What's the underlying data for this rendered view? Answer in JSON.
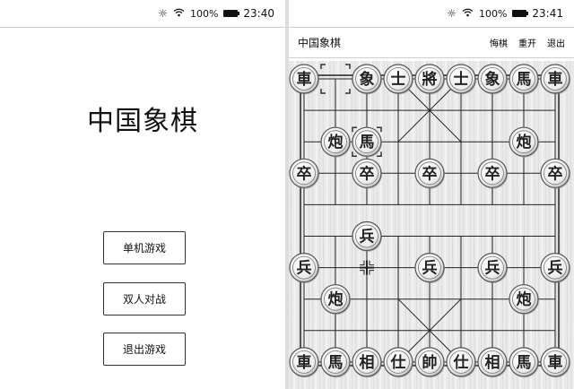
{
  "left_screen": {
    "status": {
      "battery": "100%",
      "time": "23:40"
    },
    "title": "中国象棋",
    "buttons": [
      "单机游戏",
      "双人对战",
      "退出游戏"
    ]
  },
  "right_screen": {
    "status": {
      "battery": "100%",
      "time": "23:41"
    },
    "header": {
      "title": "中国象棋",
      "undo": "悔棋",
      "restart": "重开",
      "exit": "退出"
    },
    "board": {
      "top_side": [
        {
          "name": "車",
          "col": 0,
          "row": 0
        },
        {
          "name": "象",
          "col": 2,
          "row": 0
        },
        {
          "name": "士",
          "col": 3,
          "row": 0
        },
        {
          "name": "將",
          "col": 4,
          "row": 0
        },
        {
          "name": "士",
          "col": 5,
          "row": 0
        },
        {
          "name": "象",
          "col": 6,
          "row": 0
        },
        {
          "name": "馬",
          "col": 7,
          "row": 0
        },
        {
          "name": "車",
          "col": 8,
          "row": 0
        },
        {
          "name": "炮",
          "col": 1,
          "row": 2
        },
        {
          "name": "馬",
          "col": 2,
          "row": 2
        },
        {
          "name": "炮",
          "col": 7,
          "row": 2
        },
        {
          "name": "卒",
          "col": 0,
          "row": 3
        },
        {
          "name": "卒",
          "col": 2,
          "row": 3
        },
        {
          "name": "卒",
          "col": 4,
          "row": 3
        },
        {
          "name": "卒",
          "col": 6,
          "row": 3
        },
        {
          "name": "卒",
          "col": 8,
          "row": 3
        }
      ],
      "bottom_side": [
        {
          "name": "兵",
          "col": 2,
          "row": 5
        },
        {
          "name": "兵",
          "col": 0,
          "row": 6
        },
        {
          "name": "兵",
          "col": 4,
          "row": 6
        },
        {
          "name": "兵",
          "col": 6,
          "row": 6
        },
        {
          "name": "兵",
          "col": 8,
          "row": 6
        },
        {
          "name": "炮",
          "col": 1,
          "row": 7
        },
        {
          "name": "炮",
          "col": 7,
          "row": 7
        },
        {
          "name": "車",
          "col": 0,
          "row": 9
        },
        {
          "name": "馬",
          "col": 1,
          "row": 9
        },
        {
          "name": "相",
          "col": 2,
          "row": 9
        },
        {
          "name": "仕",
          "col": 3,
          "row": 9
        },
        {
          "name": "帥",
          "col": 4,
          "row": 9
        },
        {
          "name": "仕",
          "col": 5,
          "row": 9
        },
        {
          "name": "相",
          "col": 6,
          "row": 9
        },
        {
          "name": "馬",
          "col": 7,
          "row": 9
        },
        {
          "name": "車",
          "col": 8,
          "row": 9
        }
      ],
      "last_move": {
        "from": {
          "col": 1,
          "row": 0
        },
        "to": {
          "col": 2,
          "row": 2
        }
      },
      "selected_point": {
        "col": 2,
        "row": 6
      }
    }
  }
}
